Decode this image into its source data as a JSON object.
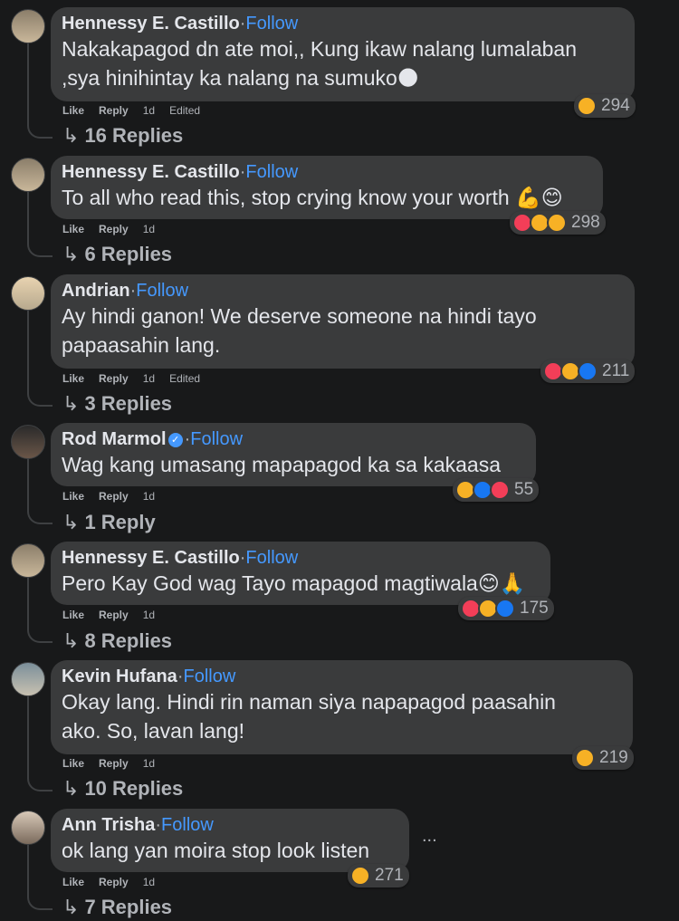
{
  "ui": {
    "follow": "Follow",
    "like": "Like",
    "reply": "Reply",
    "dot": "·",
    "reply_arrow": "↳",
    "more": "..."
  },
  "comments": [
    {
      "name": "Hennessy E. Castillo",
      "verified": false,
      "lines": [
        "Nakakapagod dn ate moi,, Kung ikaw nalang lumalaban",
        ",sya hinihintay ka nalang na sumuko🌑"
      ],
      "time": "1d",
      "edited": "Edited",
      "reaction_icons": [
        "sad"
      ],
      "reaction_count": "294",
      "replies": "16 Replies"
    },
    {
      "name": "Hennessy E. Castillo",
      "verified": false,
      "lines": [
        "To all who read this, stop crying know your worth 💪😊"
      ],
      "time": "1d",
      "edited": "",
      "reaction_icons": [
        "love",
        "care",
        "sad"
      ],
      "reaction_count": "298",
      "replies": "6 Replies"
    },
    {
      "name": "Andrian",
      "verified": false,
      "lines": [
        "Ay hindi ganon! We deserve someone na hindi tayo",
        "papaasahin lang."
      ],
      "time": "1d",
      "edited": "Edited",
      "reaction_icons": [
        "love",
        "care",
        "like"
      ],
      "reaction_count": "211",
      "replies": "3 Replies"
    },
    {
      "name": "Rod Marmol",
      "verified": true,
      "lines": [
        "Wag kang umasang mapapagod ka sa kakaasa"
      ],
      "time": "1d",
      "edited": "",
      "reaction_icons": [
        "sad",
        "like",
        "love"
      ],
      "reaction_count": "55",
      "replies": "1 Reply"
    },
    {
      "name": "Hennessy E. Castillo",
      "verified": false,
      "lines": [
        "Pero Kay God wag Tayo mapagod magtiwala😊🙏"
      ],
      "time": "1d",
      "edited": "",
      "reaction_icons": [
        "love",
        "care",
        "like"
      ],
      "reaction_count": "175",
      "replies": "8 Replies"
    },
    {
      "name": "Kevin Hufana",
      "verified": false,
      "lines": [
        "Okay lang. Hindi rin naman siya napapagod paasahin",
        "ako. So, lavan lang!"
      ],
      "time": "1d",
      "edited": "",
      "reaction_icons": [
        "haha"
      ],
      "reaction_count": "219",
      "replies": "10 Replies"
    },
    {
      "name": "Ann Trisha",
      "verified": false,
      "lines": [
        "ok lang yan moira stop look listen"
      ],
      "time": "1d",
      "edited": "",
      "reaction_icons": [
        "haha"
      ],
      "reaction_count": "271",
      "replies": "7 Replies"
    }
  ]
}
